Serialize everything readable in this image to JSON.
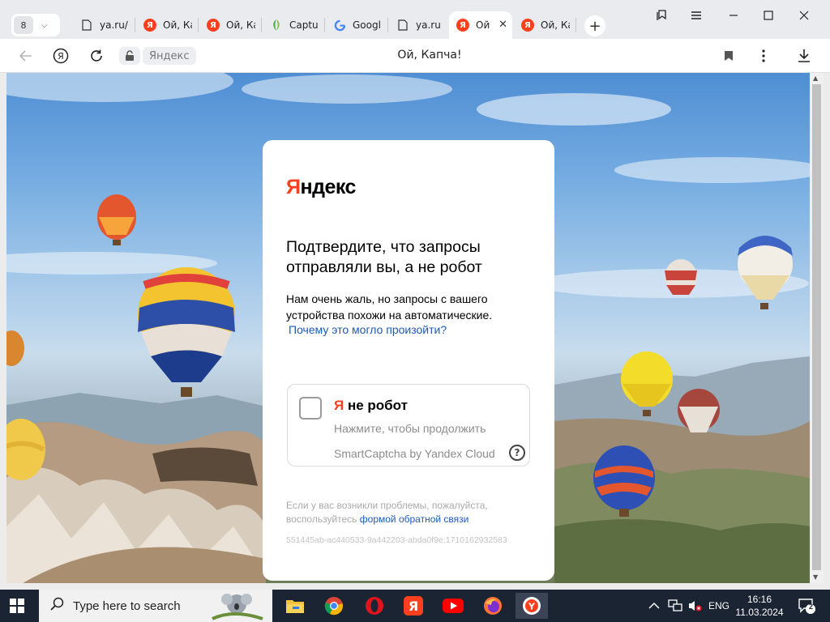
{
  "tabs": {
    "count": "8",
    "items": [
      {
        "label": "ya.ru/",
        "icon": "page-icon"
      },
      {
        "label": "Ой, Ка",
        "icon": "yandex-icon"
      },
      {
        "label": "Ой, Ка",
        "icon": "yandex-icon"
      },
      {
        "label": "Captu",
        "icon": "captcha-icon"
      },
      {
        "label": "Googl",
        "icon": "google-icon"
      },
      {
        "label": "ya.ru",
        "icon": "page-icon"
      },
      {
        "label": "Ой",
        "icon": "yandex-icon",
        "active": true
      },
      {
        "label": "Ой, Ка",
        "icon": "yandex-icon"
      }
    ]
  },
  "address_bar": {
    "site_chip": "Яндекс",
    "page_title": "Ой, Капча!"
  },
  "card": {
    "logo": {
      "first": "Я",
      "rest": "ндекс"
    },
    "heading": "Подтвердите, что запросы отправляли вы, а не робот",
    "text": "Нам очень жаль, но запросы с вашего устройства похожи на автоматические.",
    "why_link": "Почему это могло произойти?",
    "captcha": {
      "title_first": "Я",
      "title_rest": " не робот",
      "subtitle": "Нажмите, чтобы продолжить",
      "brand": "SmartCaptcha by Yandex Cloud",
      "help": "?"
    },
    "footer_text": "Если у вас возникли проблемы, пожалуйста, воспользуйтесь",
    "footer_link": "формой обратной связи",
    "request_id": "551445ab-ac440533-9a442203-abda0f9e:1710162932583"
  },
  "taskbar": {
    "search_placeholder": "Type here to search",
    "language": "ENG",
    "time": "16:16",
    "date": "11.03.2024",
    "notifications": "2"
  },
  "colors": {
    "yandex_red": "#fc3f1d",
    "link_blue": "#1d5ab5",
    "taskbar": "#1b2432"
  }
}
